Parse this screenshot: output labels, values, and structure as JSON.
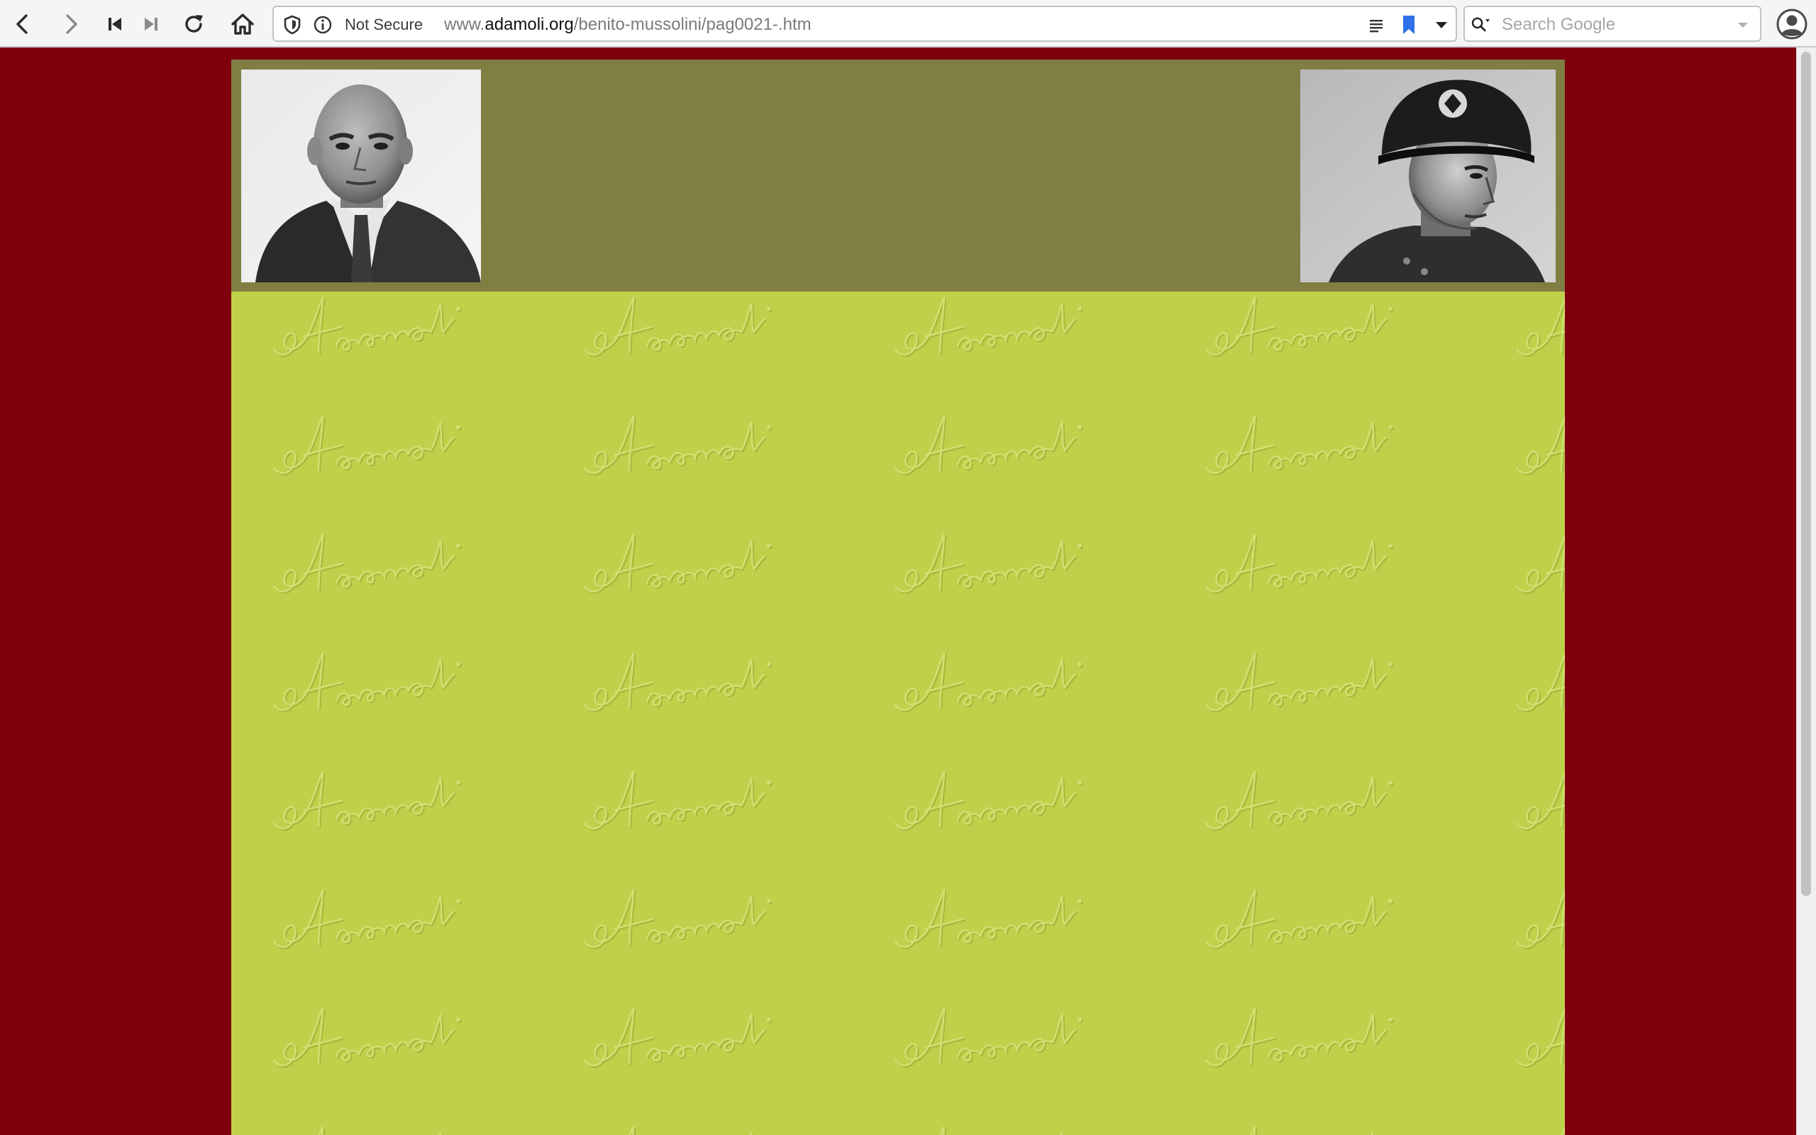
{
  "browser": {
    "nav": {
      "back_icon": "chevron-left-icon",
      "forward_icon": "chevron-right-icon",
      "first_icon": "skip-back-icon",
      "last_icon": "skip-forward-icon",
      "reload_icon": "reload-icon",
      "home_icon": "home-icon"
    },
    "address": {
      "security_label": "Not Secure",
      "url_prefix": "www.",
      "url_domain": "adamoli.org",
      "url_path": "/benito-mussolini/pag0021-.htm"
    },
    "search": {
      "placeholder": "Search Google"
    }
  },
  "page": {
    "background_color": "#7e000c",
    "header_color": "#807e43",
    "body_color": "#bfd04a",
    "watermark_text": "Adamoli",
    "left_image": "mussolini-portrait-suit",
    "right_image": "mussolini-portrait-helmet"
  }
}
